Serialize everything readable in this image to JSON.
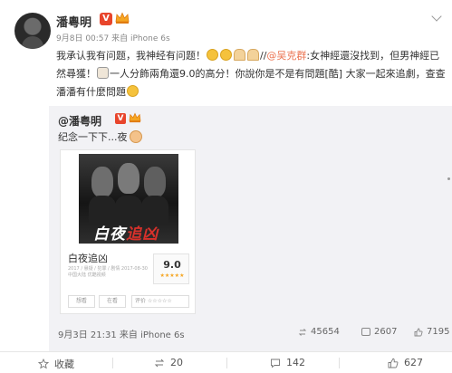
{
  "post": {
    "username": "潘粵明",
    "vip_badge": "V",
    "meta": "9月8日 00:57 来自 iPhone 6s",
    "text_part1": "我承认我有问题，我神经有问题！",
    "text_part2": "//",
    "mention": "@吴克群",
    "text_part3": ":女神經還沒找到，但男神經已然尋獲！",
    "text_part4": "一人分飾兩角還9.0的高分！你說你是不是有問題[酷] 大家一起來追劇，查查潘潘有什麼問題"
  },
  "quote": {
    "username": "@潘粤明",
    "vip_badge": "V",
    "text": "纪念一下下...夜",
    "card": {
      "poster_title_a": "白夜",
      "poster_title_b": "追凶",
      "title": "白夜追凶",
      "info": "2017 / 悬疑 / 犯罪 / 剧情 2017-08-30 中国大陆 优酷视频",
      "score": "9.0",
      "stars": "★★★★★",
      "btn_want": "想看",
      "btn_seen": "在看",
      "rate_label": "评价 ☆☆☆☆☆"
    },
    "meta": "9月3日 21:31 来自 iPhone 6s",
    "reposts": "45654",
    "comments": "2607",
    "likes": "7195"
  },
  "footer": {
    "favorite": "收藏",
    "reposts": "20",
    "comments": "142",
    "likes": "627"
  },
  "colors": {
    "accent": "#eb7350",
    "vip": "#e8452c",
    "quote_bg": "#f2f2f5"
  },
  "icons": [
    "chevron-down-icon",
    "crown-icon",
    "star-icon",
    "repost-icon",
    "comment-icon",
    "like-icon"
  ]
}
